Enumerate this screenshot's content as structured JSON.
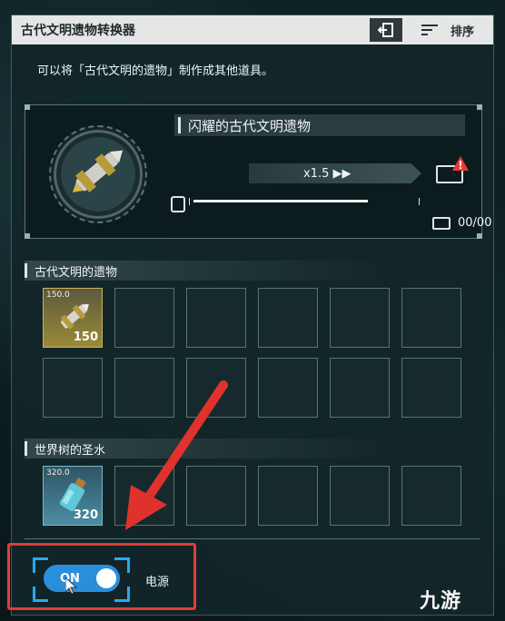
{
  "window": {
    "title": "古代文明遗物转换器",
    "sort_label": "排序"
  },
  "description": "可以将「古代文明的遗物」制作成其他道具。",
  "recipe": {
    "item_name": "闪耀的古代文明遗物",
    "speed": "x1.5 ▶▶",
    "progress": 0.8,
    "count": "00/00"
  },
  "sections": [
    {
      "label": "古代文明的遗物",
      "slots": [
        {
          "weight": "150.0",
          "qty": "150",
          "kind": "gold"
        },
        {},
        {},
        {},
        {},
        {},
        {},
        {},
        {},
        {},
        {},
        {}
      ]
    },
    {
      "label": "世界树的圣水",
      "slots": [
        {
          "weight": "320.0",
          "qty": "320",
          "kind": "blue"
        },
        {},
        {},
        {},
        {},
        {}
      ]
    }
  ],
  "power": {
    "toggle_text": "ON",
    "label": "电源",
    "state": "on"
  },
  "watermark": "九游",
  "colors": {
    "accent": "#2a8fda",
    "highlight": "#e53b35",
    "gold": "#c9b35a"
  }
}
